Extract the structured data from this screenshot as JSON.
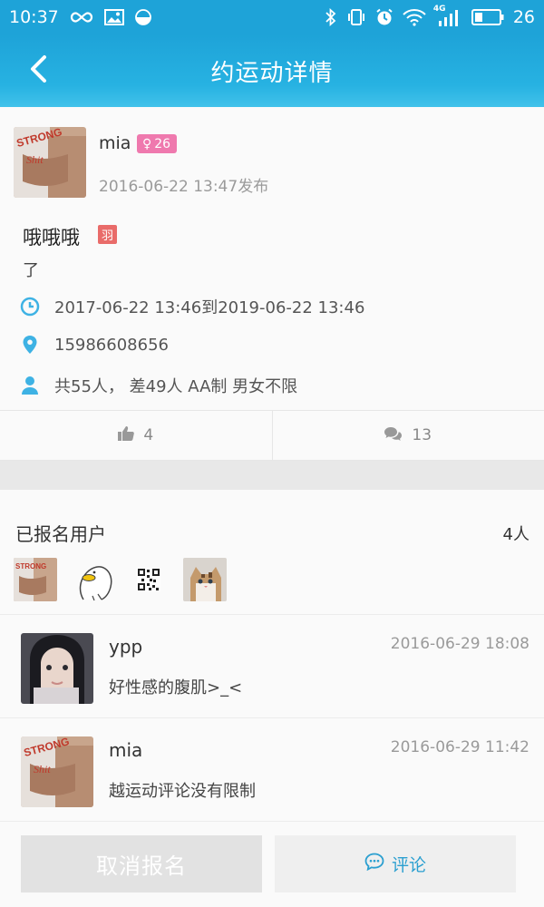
{
  "status_bar": {
    "time": "10:37",
    "network": "4G",
    "battery": "26",
    "icons": [
      "infinity-icon",
      "image-icon",
      "half-circle-icon",
      "bluetooth-icon",
      "vibrate-icon",
      "alarm-icon",
      "wifi-icon",
      "signal-icon",
      "battery-icon"
    ]
  },
  "navbar": {
    "title": "约运动详情",
    "back_icon": "chevron-left-icon"
  },
  "poster": {
    "name": "mia",
    "gender_symbol": "♀",
    "age": "26",
    "posted_time": "2016-06-22 13:47发布"
  },
  "event": {
    "title": "哦哦哦",
    "sport_tag": "羽",
    "description": "了",
    "time_range": "2017-06-22 13:46到2019-06-22 13:46",
    "phone": "15986608656",
    "people_info": "共55人， 差49人 AA制 男女不限"
  },
  "actions": {
    "likes": "4",
    "comments": "13"
  },
  "signup": {
    "label": "已报名用户",
    "count": "4人",
    "users": [
      "avatar-mia",
      "avatar-duck",
      "avatar-qrcode",
      "avatar-cat"
    ]
  },
  "comments": [
    {
      "name": "ypp",
      "time": "2016-06-29 18:08",
      "text": "好性感的腹肌>_<"
    },
    {
      "name": "mia",
      "time": "2016-06-29 11:42",
      "text": "越运动评论没有限制"
    }
  ],
  "bottom": {
    "cancel_label": "取消报名",
    "comment_label": "评论"
  },
  "colors": {
    "accent": "#1ea3d8",
    "gender_badge": "#ef79ae",
    "sport_badge": "#e96b69",
    "info_icon": "#3eb2e4"
  }
}
